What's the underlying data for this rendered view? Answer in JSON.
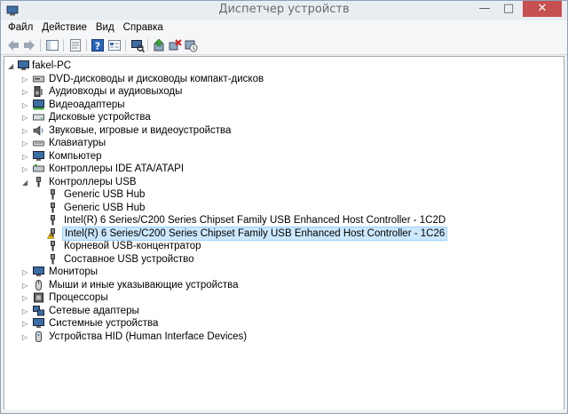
{
  "window": {
    "title": "Диспетчер устройств"
  },
  "window_buttons": {
    "minimize": "—",
    "maximize": "□",
    "close": "✕"
  },
  "menu": [
    {
      "label": "Файл"
    },
    {
      "label": "Действие"
    },
    {
      "label": "Вид"
    },
    {
      "label": "Справка"
    }
  ],
  "toolbar": {
    "buttons": [
      "back-icon",
      "forward-icon",
      "show-hide-tree-icon",
      "properties-icon",
      "help-icon",
      "view-icon",
      "scan-hardware-icon",
      "update-driver-icon",
      "uninstall-device-icon",
      "disable-device-icon"
    ]
  },
  "tree": {
    "root": "fakel-PC",
    "nodes": [
      {
        "label": "DVD-дисководы и дисководы компакт-дисков",
        "icon": "dvd-drive-icon",
        "expanded": false
      },
      {
        "label": "Аудиовходы и аудиовыходы",
        "icon": "speaker-icon",
        "expanded": false
      },
      {
        "label": "Видеоадаптеры",
        "icon": "display-adapter-icon",
        "expanded": false
      },
      {
        "label": "Дисковые устройства",
        "icon": "disk-drive-icon",
        "expanded": false
      },
      {
        "label": "Звуковые, игровые и видеоустройства",
        "icon": "sound-device-icon",
        "expanded": false
      },
      {
        "label": "Клавиатуры",
        "icon": "keyboard-icon",
        "expanded": false
      },
      {
        "label": "Компьютер",
        "icon": "computer-icon",
        "expanded": false
      },
      {
        "label": "Контроллеры IDE ATA/ATAPI",
        "icon": "ide-controller-icon",
        "expanded": false
      },
      {
        "label": "Контроллеры USB",
        "icon": "usb-controller-icon",
        "expanded": true,
        "children": [
          {
            "label": "Generic USB Hub",
            "icon": "usb-device-icon"
          },
          {
            "label": "Generic USB Hub",
            "icon": "usb-device-icon"
          },
          {
            "label": "Intel(R) 6 Series/C200 Series Chipset Family USB Enhanced Host Controller - 1C2D",
            "icon": "usb-device-icon"
          },
          {
            "label": "Intel(R) 6 Series/C200 Series Chipset Family USB Enhanced Host Controller - 1C26",
            "icon": "warning-usb-device-icon",
            "selected": true
          },
          {
            "label": "Корневой USB-концентратор",
            "icon": "usb-device-icon"
          },
          {
            "label": "Составное USB устройство",
            "icon": "usb-device-icon"
          }
        ]
      },
      {
        "label": "Мониторы",
        "icon": "monitor-icon",
        "expanded": false
      },
      {
        "label": "Мыши и иные указывающие устройства",
        "icon": "mouse-icon",
        "expanded": false
      },
      {
        "label": "Процессоры",
        "icon": "processor-icon",
        "expanded": false
      },
      {
        "label": "Сетевые адаптеры",
        "icon": "network-adapter-icon",
        "expanded": false
      },
      {
        "label": "Системные устройства",
        "icon": "system-device-icon",
        "expanded": false
      },
      {
        "label": "Устройства HID (Human Interface Devices)",
        "icon": "hid-device-icon",
        "expanded": false
      }
    ]
  }
}
